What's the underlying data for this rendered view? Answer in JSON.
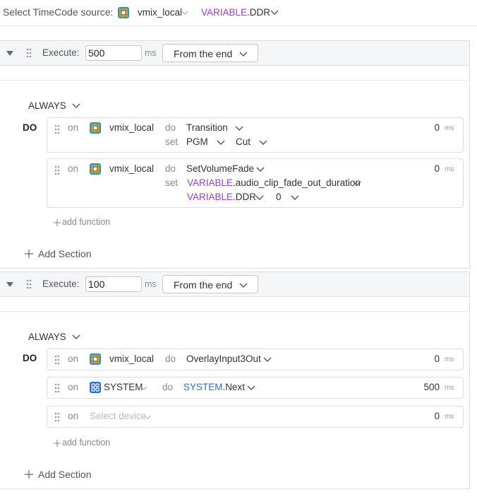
{
  "header": {
    "source_label": "Select TimeCode source:",
    "device": "vmix_local",
    "variable_prefix": "VARIABLE",
    "variable_name": ".DDR"
  },
  "blocks": [
    {
      "execute_label": "Execute:",
      "execute_value": "500",
      "ms_label": "ms",
      "anchor": "From the end",
      "condition": "ALWAYS",
      "do_label": "DO",
      "rows": [
        {
          "on": "on",
          "device": "vmix_local",
          "do": "do",
          "function": "Transition",
          "set": "set",
          "param1": "PGM",
          "param2": "Cut",
          "delay": "0",
          "ms": "ms"
        },
        {
          "on": "on",
          "device": "vmix_local",
          "do": "do",
          "function": "SetVolumeFade",
          "set": "set",
          "param1_prefix": "VARIABLE",
          "param1_name": ".audio_clip_fade_out_duration",
          "param2_prefix": "VARIABLE",
          "param2_name": ".DDR",
          "param3": "0",
          "delay": "0",
          "ms": "ms"
        }
      ],
      "add_function": "add function",
      "add_section": "Add Section"
    },
    {
      "execute_label": "Execute:",
      "execute_value": "100",
      "ms_label": "ms",
      "anchor": "From the end",
      "condition": "ALWAYS",
      "do_label": "DO",
      "rows": [
        {
          "on": "on",
          "device": "vmix_local",
          "do": "do",
          "function": "OverlayInput3Out",
          "delay": "0",
          "ms": "ms"
        },
        {
          "on": "on",
          "device": "SYSTEM",
          "do": "do",
          "function_prefix": "SYSTEM",
          "function_name": ".Next",
          "delay": "500",
          "ms": "ms"
        },
        {
          "on": "on",
          "device_placeholder": "Select device",
          "delay": "0",
          "ms": "ms"
        }
      ],
      "add_function": "add function",
      "add_section": "Add Section"
    }
  ],
  "colors": {
    "variable": "#9b40d6",
    "system": "#2f6fd8",
    "vmix_icon_green": "#6cc04a",
    "vmix_icon_blue": "#3a7bd5",
    "vmix_icon_orange": "#f08a24"
  }
}
